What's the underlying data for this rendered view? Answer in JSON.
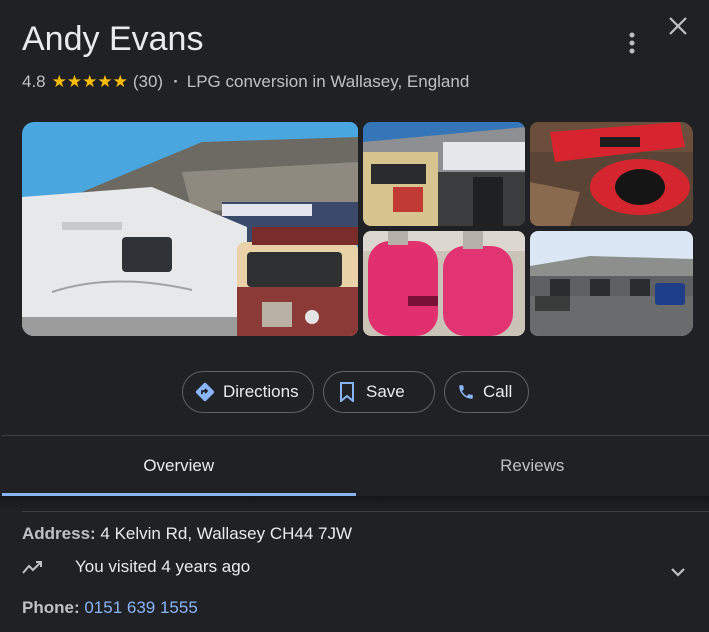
{
  "header": {
    "title": "Andy Evans",
    "more_icon": "more-vert-icon",
    "close_icon": "close-icon"
  },
  "rating": {
    "value": "4.8",
    "stars": "★★★★★",
    "count": "(30)",
    "separator": "·",
    "category": "LPG conversion in Wallasey, England",
    "star_color": "#fbbc04"
  },
  "photos": [
    {
      "name": "photo-motorhome-and-van"
    },
    {
      "name": "photo-auto-gas-garage"
    },
    {
      "name": "photo-red-cylinder-parts"
    },
    {
      "name": "photo-pink-gas-bottles"
    },
    {
      "name": "photo-industrial-units"
    }
  ],
  "actions": {
    "directions": {
      "label": "Directions",
      "icon": "directions-icon"
    },
    "save": {
      "label": "Save",
      "icon": "bookmark-icon"
    },
    "call": {
      "label": "Call",
      "icon": "phone-icon"
    }
  },
  "tabs": {
    "overview": "Overview",
    "reviews": "Reviews",
    "active": "overview",
    "accent": "#8ab4f8"
  },
  "info": {
    "address_label": "Address:",
    "address_value": " 4 Kelvin Rd, Wallasey CH44 7JW",
    "visited_text": "You visited 4 years ago",
    "visited_icon": "trending-icon",
    "phone_label": "Phone:",
    "phone_value": " 0151 639 1555",
    "expand_icon": "chevron-down-icon"
  }
}
